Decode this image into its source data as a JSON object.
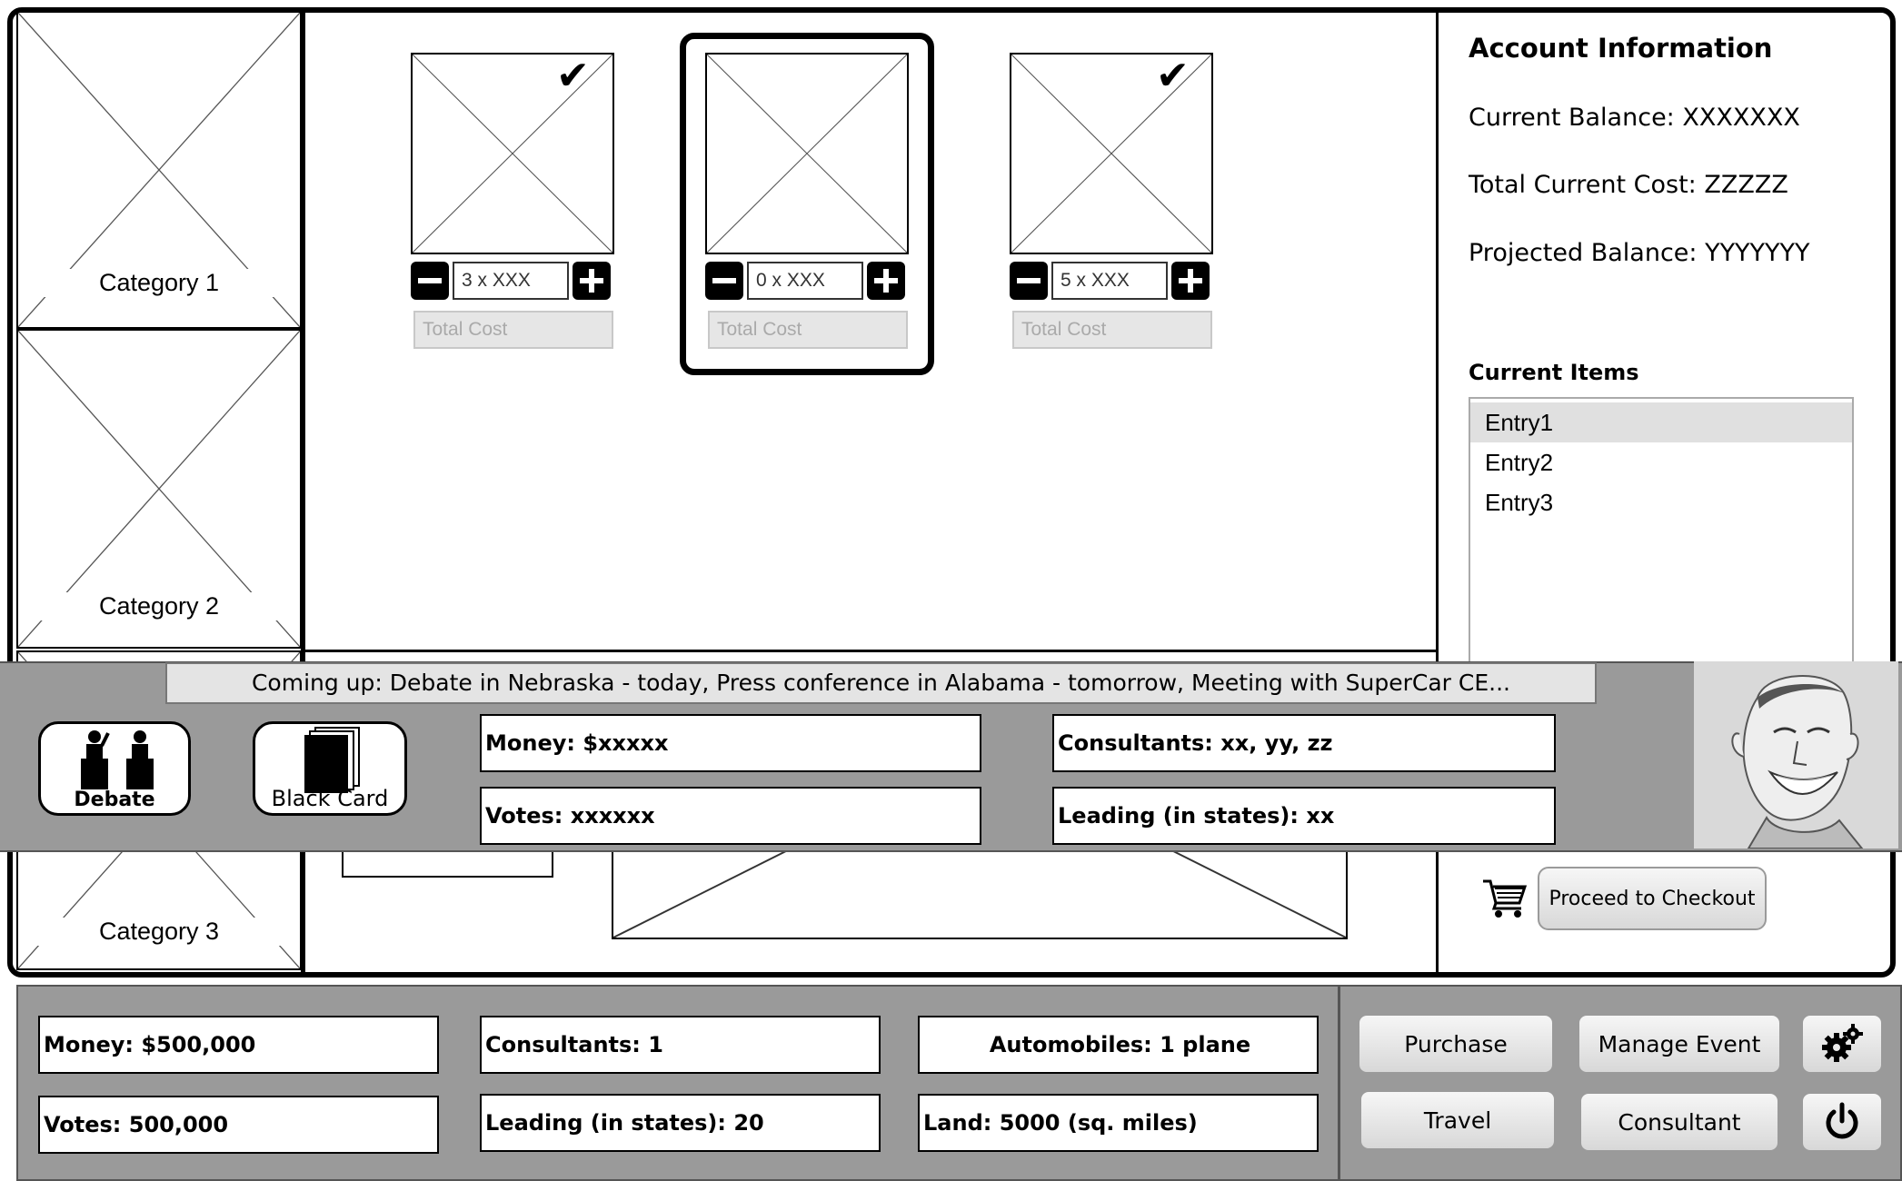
{
  "categories": [
    {
      "label": "Category 1"
    },
    {
      "label": "Category 2"
    },
    {
      "label": "Category 3"
    }
  ],
  "products": [
    {
      "qty": "3 x XXX",
      "total_placeholder": "Total Cost",
      "checked": true
    },
    {
      "qty": "0 x XXX",
      "total_placeholder": "Total Cost",
      "checked": false
    },
    {
      "qty": "5 x XXX",
      "total_placeholder": "Total Cost",
      "checked": true
    }
  ],
  "account": {
    "title": "Account Information",
    "current_balance": "Current Balance: XXXXXXX",
    "total_current_cost": "Total Current Cost: ZZZZZ",
    "projected_balance": "Projected Balance: YYYYYYY",
    "current_items_title": "Current Items",
    "items": [
      "Entry1",
      "Entry2",
      "Entry3"
    ],
    "checkout_label": "Proceed to Checkout"
  },
  "event_bar": {
    "ticker": "Coming up: Debate in Nebraska - today, Press conference in Alabama - tomorrow, Meeting with SuperCar CE...",
    "debate_label": "Debate",
    "black_card_label": "Black Card",
    "money": "Money: $xxxxx",
    "votes": "Votes: xxxxxx",
    "consultants": "Consultants: xx, yy, zz",
    "leading": "Leading (in states): xx"
  },
  "status_bar": {
    "money": "Money: $500,000",
    "votes": "Votes: 500,000",
    "consultants": "Consultants: 1",
    "leading": "Leading (in states): 20",
    "automobiles": "Automobiles: 1 plane",
    "land": "Land: 5000 (sq. miles)"
  },
  "buttons": {
    "purchase": "Purchase",
    "manage_event": "Manage Event",
    "travel": "Travel",
    "consultant": "Consultant"
  },
  "icons": {
    "settings": "gears-icon",
    "power": "power-icon",
    "cart": "shopping-cart-icon",
    "check": "checkmark-icon"
  }
}
